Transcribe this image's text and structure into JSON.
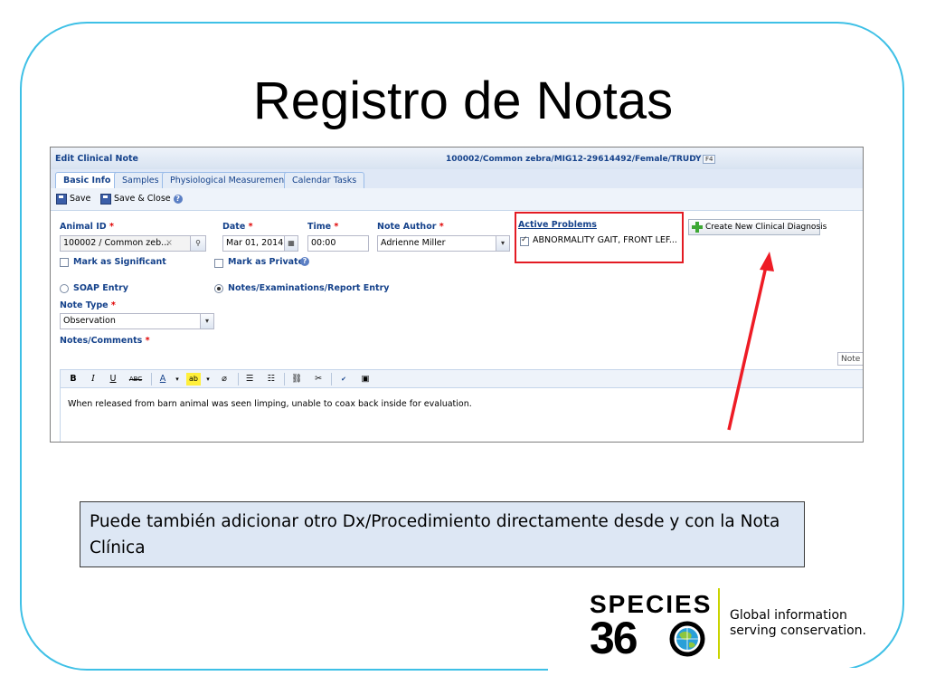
{
  "slide": {
    "title": "Registro de Notas",
    "callout": "Puede también adicionar otro Dx/Procedimiento directamente desde y con la Nota Clínica"
  },
  "app": {
    "window_title": "Edit Clinical Note",
    "record": "100002/Common zebra/MIG12-29614492/Female/TRUDY",
    "record_badge": "F4",
    "tabs": [
      {
        "label": "Basic Info",
        "active": true
      },
      {
        "label": "Samples",
        "active": false
      },
      {
        "label": "Physiological Measurements",
        "active": false
      },
      {
        "label": "Calendar Tasks",
        "active": false
      }
    ],
    "toolbar": {
      "save_label": "Save",
      "save_close_label": "Save & Close"
    },
    "form": {
      "animal_id_label": "Animal ID",
      "animal_id_value": "100002 / Common zeb...",
      "date_label": "Date",
      "date_value": "Mar 01, 2014",
      "time_label": "Time",
      "time_value": "00:00",
      "author_label": "Note Author",
      "author_value": "Adrienne Miller",
      "required_mark": "*",
      "significant_label": "Mark as Significant",
      "private_label": "Mark as Private",
      "soap_label": "SOAP Entry",
      "notes_entry_label": "Notes/Examinations/Report Entry",
      "note_type_label": "Note Type",
      "note_type_value": "Observation",
      "comments_label": "Notes/Comments",
      "note_tag": "Note",
      "comment_text": "When released from barn animal was seen limping, unable to coax back inside for evaluation."
    },
    "active_problems": {
      "title": "Active Problems",
      "item": "ABNORMALITY GAIT, FRONT LEF...",
      "create_button": "Create New Clinical Diagnosis"
    },
    "editor_buttons": [
      "B",
      "I",
      "U",
      "ABC",
      "A",
      "ab"
    ]
  },
  "logo": {
    "wordmark_top": "SPECIES",
    "wordmark_bottom": "36",
    "tagline_line1": "Global information",
    "tagline_line2": "serving conservation."
  },
  "colors": {
    "frame": "#3ec0e6",
    "highlight_box": "#e31b23",
    "callout_bg": "#dde7f4",
    "logo_divider": "#c9d400"
  }
}
